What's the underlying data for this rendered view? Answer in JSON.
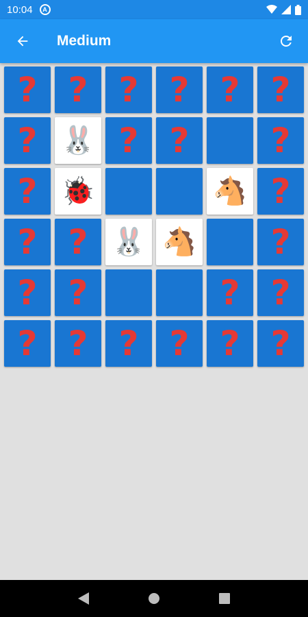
{
  "status_bar": {
    "time": "10:04",
    "notification_icon": "circle-a-icon"
  },
  "app_bar": {
    "title": "Medium",
    "back_icon": "arrow-left-icon",
    "refresh_icon": "refresh-icon"
  },
  "colors": {
    "primary": "#2196f3",
    "status_bar": "#1e88e5",
    "card_hidden": "#1976d2",
    "card_revealed": "#ffffff",
    "question_mark": "#e53935",
    "background": "#e0e0e0"
  },
  "card_hidden_symbol": "?",
  "board": [
    [
      "hidden",
      "hidden",
      "hidden",
      "hidden",
      "hidden",
      "hidden"
    ],
    [
      "hidden",
      "rabbit",
      "hidden",
      "hidden",
      "matched",
      "hidden"
    ],
    [
      "hidden",
      "ladybug",
      "matched",
      "matched",
      "horse",
      "hidden"
    ],
    [
      "hidden",
      "hidden",
      "rabbit",
      "horse",
      "matched",
      "hidden"
    ],
    [
      "hidden",
      "hidden",
      "matched",
      "matched",
      "hidden",
      "hidden"
    ],
    [
      "hidden",
      "hidden",
      "hidden",
      "hidden",
      "hidden",
      "hidden"
    ]
  ],
  "emoji_map": {
    "rabbit": "🐰",
    "ladybug": "🐞",
    "horse": "🐴"
  }
}
